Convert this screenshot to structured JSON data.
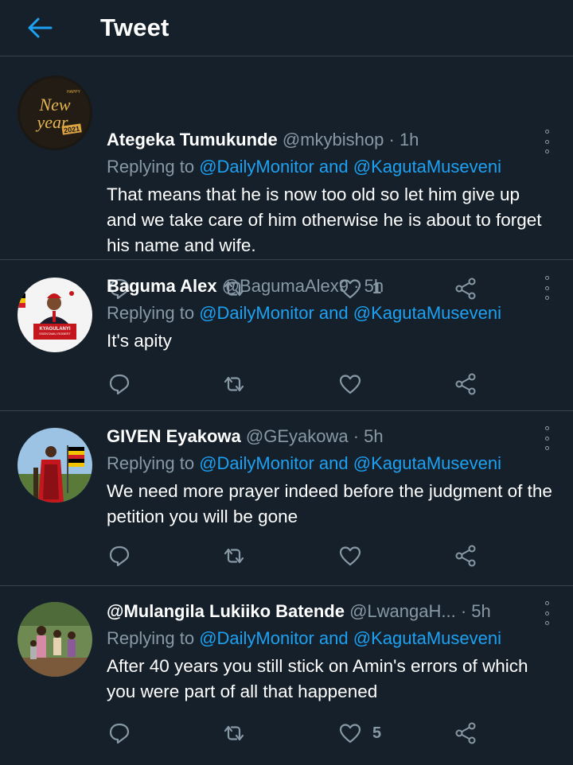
{
  "header": {
    "title": "Tweet"
  },
  "tweets": [
    {
      "name": "Ategeka Tumukunde",
      "handle": "@mkybishop",
      "time": "· 1h",
      "replying_prefix": "Replying to",
      "reply_to_1": "@DailyMonitor",
      "reply_and": "and",
      "reply_to_2": "@KagutaMuseveni",
      "text": "That means that he is now too old so let him give up and we take care of him otherwise he is about to forget his name and wife.",
      "likes": "1",
      "avatar_text": {
        "line1": "New",
        "line2": "year",
        "year": "2021",
        "top": "HAPPY"
      }
    },
    {
      "name": "Baguma Alex",
      "handle": "@BagumaAlex9",
      "time": "· 5h",
      "replying_prefix": "Replying to",
      "reply_to_1": "@DailyMonitor",
      "reply_and": "and",
      "reply_to_2": "@KagutaMuseveni",
      "text": "It's apity",
      "likes": "",
      "avatar_text": {
        "line1": "KYAGULANYI",
        "line2": "SSENTAMU ROBERT"
      }
    },
    {
      "name": "GIVEN Eyakowa",
      "handle": "@GEyakowa",
      "time": "· 5h",
      "replying_prefix": "Replying to",
      "reply_to_1": "@DailyMonitor",
      "reply_and": "and",
      "reply_to_2": "@KagutaMuseveni",
      "text": "We need more prayer indeed before the judgment of the petition you will be gone",
      "likes": ""
    },
    {
      "name": "@Mulangila Lukiiko Batende",
      "handle": "@LwangaH...",
      "time": "· 5h",
      "replying_prefix": "Replying to",
      "reply_to_1": "@DailyMonitor",
      "reply_and": "and",
      "reply_to_2": "@KagutaMuseveni",
      "text": "After 40 years you still stick on Amin's errors of which you were part of all that happened",
      "likes": "5"
    }
  ],
  "icons": {
    "back": "arrow-left-icon",
    "more": "more-vertical-icon",
    "reply": "reply-icon",
    "retweet": "retweet-icon",
    "like": "heart-icon",
    "share": "share-icon"
  },
  "colors": {
    "background": "#15202b",
    "link": "#1da1f2",
    "muted": "#8899a6",
    "divider": "#38444d"
  }
}
